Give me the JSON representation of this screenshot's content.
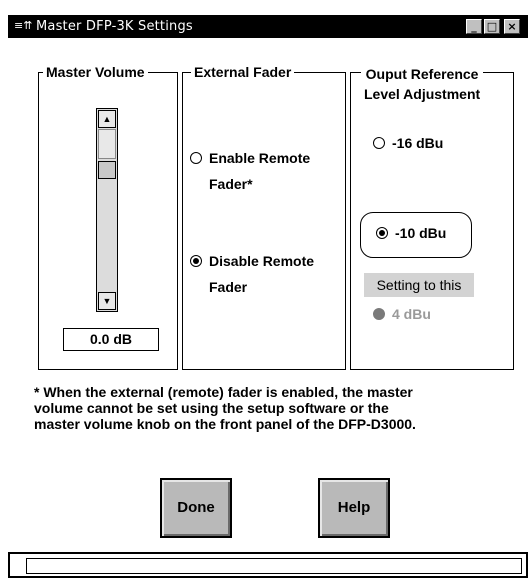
{
  "window": {
    "title": "Master DFP-3K Settings",
    "system_icon": "≡⇈",
    "minimize_glyph": "_",
    "maximize_glyph": "□",
    "close_glyph": "×"
  },
  "master_volume": {
    "label": "Master Volume",
    "value": "0.0 dB",
    "scroll_up_glyph": "▲",
    "scroll_down_glyph": "▼"
  },
  "external_fader": {
    "label": "External Fader",
    "options": [
      {
        "label_line1": "Enable Remote",
        "label_line2": "Fader*",
        "selected": false
      },
      {
        "label_line1": "Disable Remote",
        "label_line2": "Fader",
        "selected": true
      }
    ]
  },
  "output_reference": {
    "label_line1": "Ouput Reference",
    "label_line2": "Level Adjustment",
    "options": [
      {
        "label": "-16 dBu",
        "selected": false,
        "enabled": true
      },
      {
        "label": "-10 dBu",
        "selected": true,
        "enabled": true
      },
      {
        "label": "4 dBu",
        "selected": false,
        "enabled": false
      }
    ],
    "setting_tag": "Setting to this"
  },
  "note": {
    "line1": "* When the external (remote) fader is enabled, the master",
    "line2": "volume cannot be set using the setup software or the",
    "line3": "master volume knob on the front panel of the DFP-D3000."
  },
  "buttons": {
    "done_label": "Done",
    "help_label": "Help"
  }
}
